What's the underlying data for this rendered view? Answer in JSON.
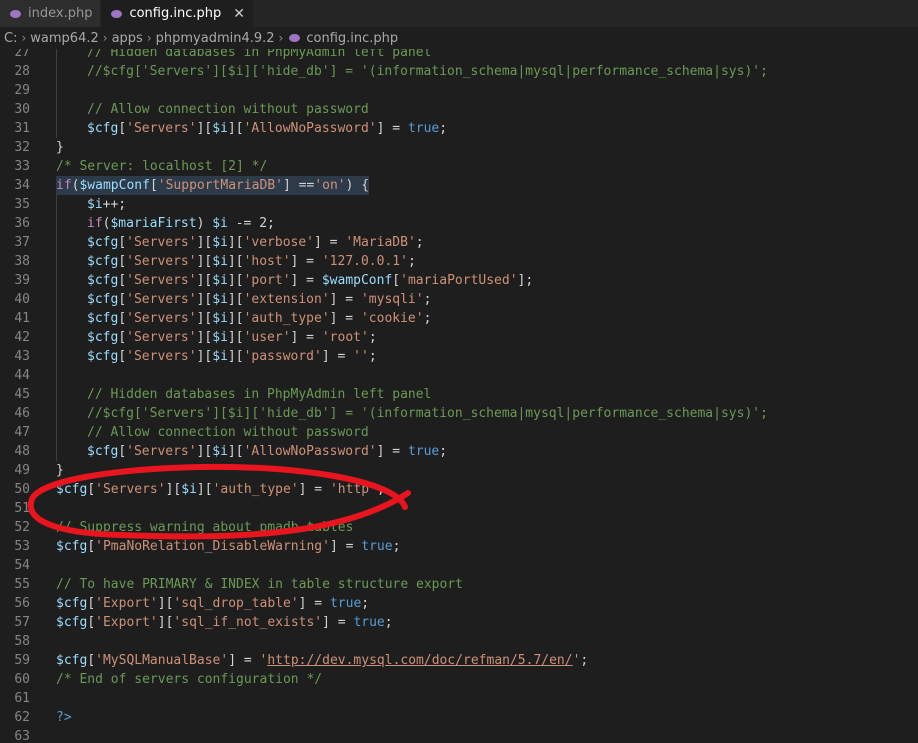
{
  "tabs": [
    {
      "label": "index.php",
      "active": false
    },
    {
      "label": "config.inc.php",
      "active": true,
      "close": "✕"
    }
  ],
  "breadcrumb": [
    "C:",
    "wamp64.2",
    "apps",
    "phpmyadmin4.9.2",
    "config.inc.php"
  ],
  "colors": {
    "keyword": "#569cd6",
    "string": "#ce9178",
    "comment": "#6a9955",
    "variable": "#9cdcfe",
    "annotation": "#e8141e"
  },
  "lines": [
    {
      "n": "27",
      "indent": 1,
      "t": [
        [
          "c",
          "// Hidden databases in PhpMyAdmin left panel"
        ]
      ]
    },
    {
      "n": "28",
      "indent": 1,
      "t": [
        [
          "c",
          "//$cfg['Servers'][$i]['hide_db'] = '(information_schema|mysql|performance_schema|sys)';"
        ]
      ]
    },
    {
      "n": "29",
      "indent": 1,
      "t": []
    },
    {
      "n": "30",
      "indent": 1,
      "t": [
        [
          "c",
          "// Allow connection without password"
        ]
      ]
    },
    {
      "n": "31",
      "indent": 1,
      "t": [
        [
          "v",
          "$cfg"
        ],
        [
          "",
          "["
        ],
        [
          "s",
          "'Servers'"
        ],
        [
          "",
          "]["
        ],
        [
          "v",
          "$i"
        ],
        [
          "",
          "]["
        ],
        [
          "s",
          "'AllowNoPassword'"
        ],
        [
          "",
          "] = "
        ],
        [
          "k",
          "true"
        ],
        [
          "",
          ";"
        ]
      ]
    },
    {
      "n": "32",
      "indent": 0,
      "t": [
        [
          "",
          "}"
        ]
      ]
    },
    {
      "n": "33",
      "indent": 0,
      "t": [
        [
          "c",
          "/* Server: localhost [2] */"
        ]
      ]
    },
    {
      "n": "34",
      "indent": 0,
      "hl": true,
      "t": [
        [
          "cf",
          "if"
        ],
        [
          "",
          "("
        ],
        [
          "v",
          "$wampConf"
        ],
        [
          "",
          "["
        ],
        [
          "s",
          "'SupportMariaDB'"
        ],
        [
          "",
          "] =="
        ],
        [
          "s",
          "'on'"
        ],
        [
          "",
          ") {"
        ]
      ]
    },
    {
      "n": "35",
      "indent": 1,
      "t": [
        [
          "v",
          "$i"
        ],
        [
          "",
          "++;"
        ]
      ]
    },
    {
      "n": "36",
      "indent": 1,
      "t": [
        [
          "cf",
          "if"
        ],
        [
          "",
          "("
        ],
        [
          "v",
          "$mariaFirst"
        ],
        [
          "",
          ") "
        ],
        [
          "v",
          "$i"
        ],
        [
          "",
          " -= 2;"
        ]
      ]
    },
    {
      "n": "37",
      "indent": 1,
      "t": [
        [
          "v",
          "$cfg"
        ],
        [
          "",
          "["
        ],
        [
          "s",
          "'Servers'"
        ],
        [
          "",
          "]["
        ],
        [
          "v",
          "$i"
        ],
        [
          "",
          "]["
        ],
        [
          "s",
          "'verbose'"
        ],
        [
          "",
          "] = "
        ],
        [
          "s",
          "'MariaDB'"
        ],
        [
          "",
          ";"
        ]
      ]
    },
    {
      "n": "38",
      "indent": 1,
      "t": [
        [
          "v",
          "$cfg"
        ],
        [
          "",
          "["
        ],
        [
          "s",
          "'Servers'"
        ],
        [
          "",
          "]["
        ],
        [
          "v",
          "$i"
        ],
        [
          "",
          "]["
        ],
        [
          "s",
          "'host'"
        ],
        [
          "",
          "] = "
        ],
        [
          "s",
          "'127.0.0.1'"
        ],
        [
          "",
          ";"
        ]
      ]
    },
    {
      "n": "39",
      "indent": 1,
      "t": [
        [
          "v",
          "$cfg"
        ],
        [
          "",
          "["
        ],
        [
          "s",
          "'Servers'"
        ],
        [
          "",
          "]["
        ],
        [
          "v",
          "$i"
        ],
        [
          "",
          "]["
        ],
        [
          "s",
          "'port'"
        ],
        [
          "",
          "] = "
        ],
        [
          "v",
          "$wampConf"
        ],
        [
          "",
          "["
        ],
        [
          "s",
          "'mariaPortUsed'"
        ],
        [
          "",
          "];"
        ]
      ]
    },
    {
      "n": "40",
      "indent": 1,
      "t": [
        [
          "v",
          "$cfg"
        ],
        [
          "",
          "["
        ],
        [
          "s",
          "'Servers'"
        ],
        [
          "",
          "]["
        ],
        [
          "v",
          "$i"
        ],
        [
          "",
          "]["
        ],
        [
          "s",
          "'extension'"
        ],
        [
          "",
          "] = "
        ],
        [
          "s",
          "'mysqli'"
        ],
        [
          "",
          ";"
        ]
      ]
    },
    {
      "n": "41",
      "indent": 1,
      "t": [
        [
          "v",
          "$cfg"
        ],
        [
          "",
          "["
        ],
        [
          "s",
          "'Servers'"
        ],
        [
          "",
          "]["
        ],
        [
          "v",
          "$i"
        ],
        [
          "",
          "]["
        ],
        [
          "s",
          "'auth_type'"
        ],
        [
          "",
          "] = "
        ],
        [
          "s",
          "'cookie'"
        ],
        [
          "",
          ";"
        ]
      ]
    },
    {
      "n": "42",
      "indent": 1,
      "t": [
        [
          "v",
          "$cfg"
        ],
        [
          "",
          "["
        ],
        [
          "s",
          "'Servers'"
        ],
        [
          "",
          "]["
        ],
        [
          "v",
          "$i"
        ],
        [
          "",
          "]["
        ],
        [
          "s",
          "'user'"
        ],
        [
          "",
          "] = "
        ],
        [
          "s",
          "'root'"
        ],
        [
          "",
          ";"
        ]
      ]
    },
    {
      "n": "43",
      "indent": 1,
      "t": [
        [
          "v",
          "$cfg"
        ],
        [
          "",
          "["
        ],
        [
          "s",
          "'Servers'"
        ],
        [
          "",
          "]["
        ],
        [
          "v",
          "$i"
        ],
        [
          "",
          "]["
        ],
        [
          "s",
          "'password'"
        ],
        [
          "",
          "] = "
        ],
        [
          "s",
          "''"
        ],
        [
          "",
          ";"
        ]
      ]
    },
    {
      "n": "44",
      "indent": 1,
      "t": []
    },
    {
      "n": "45",
      "indent": 1,
      "t": [
        [
          "c",
          "// Hidden databases in PhpMyAdmin left panel"
        ]
      ]
    },
    {
      "n": "46",
      "indent": 1,
      "t": [
        [
          "c",
          "//$cfg['Servers'][$i]['hide_db'] = '(information_schema|mysql|performance_schema|sys)';"
        ]
      ]
    },
    {
      "n": "47",
      "indent": 1,
      "t": [
        [
          "c",
          "// Allow connection without password"
        ]
      ]
    },
    {
      "n": "48",
      "indent": 1,
      "t": [
        [
          "v",
          "$cfg"
        ],
        [
          "",
          "["
        ],
        [
          "s",
          "'Servers'"
        ],
        [
          "",
          "]["
        ],
        [
          "v",
          "$i"
        ],
        [
          "",
          "]["
        ],
        [
          "s",
          "'AllowNoPassword'"
        ],
        [
          "",
          "] = "
        ],
        [
          "k",
          "true"
        ],
        [
          "",
          ";"
        ]
      ]
    },
    {
      "n": "49",
      "indent": 0,
      "t": [
        [
          "",
          "}"
        ]
      ]
    },
    {
      "n": "50",
      "indent": 0,
      "t": [
        [
          "v",
          "$cfg"
        ],
        [
          "",
          "["
        ],
        [
          "s",
          "'Servers'"
        ],
        [
          "",
          "]["
        ],
        [
          "v",
          "$i"
        ],
        [
          "",
          "]["
        ],
        [
          "s",
          "'auth_type'"
        ],
        [
          "",
          "] = "
        ],
        [
          "s",
          "'http'"
        ],
        [
          "",
          ";"
        ]
      ]
    },
    {
      "n": "51",
      "indent": 0,
      "t": []
    },
    {
      "n": "52",
      "indent": 0,
      "t": [
        [
          "c",
          "// Suppress warning about pmadb tables"
        ]
      ]
    },
    {
      "n": "53",
      "indent": 0,
      "t": [
        [
          "v",
          "$cfg"
        ],
        [
          "",
          "["
        ],
        [
          "s",
          "'PmaNoRelation_DisableWarning'"
        ],
        [
          "",
          "] = "
        ],
        [
          "k",
          "true"
        ],
        [
          "",
          ";"
        ]
      ]
    },
    {
      "n": "54",
      "indent": 0,
      "t": []
    },
    {
      "n": "55",
      "indent": 0,
      "t": [
        [
          "c",
          "// To have PRIMARY & INDEX in table structure export"
        ]
      ]
    },
    {
      "n": "56",
      "indent": 0,
      "t": [
        [
          "v",
          "$cfg"
        ],
        [
          "",
          "["
        ],
        [
          "s",
          "'Export'"
        ],
        [
          "",
          "]["
        ],
        [
          "s",
          "'sql_drop_table'"
        ],
        [
          "",
          "] = "
        ],
        [
          "k",
          "true"
        ],
        [
          "",
          ";"
        ]
      ]
    },
    {
      "n": "57",
      "indent": 0,
      "t": [
        [
          "v",
          "$cfg"
        ],
        [
          "",
          "["
        ],
        [
          "s",
          "'Export'"
        ],
        [
          "",
          "]["
        ],
        [
          "s",
          "'sql_if_not_exists'"
        ],
        [
          "",
          "] = "
        ],
        [
          "k",
          "true"
        ],
        [
          "",
          ";"
        ]
      ]
    },
    {
      "n": "58",
      "indent": 0,
      "t": []
    },
    {
      "n": "59",
      "indent": 0,
      "t": [
        [
          "v",
          "$cfg"
        ],
        [
          "",
          "["
        ],
        [
          "s",
          "'MySQLManualBase'"
        ],
        [
          "",
          "] = "
        ],
        [
          "s",
          "'"
        ],
        [
          "u",
          "http://dev.mysql.com/doc/refman/5.7/en/"
        ],
        [
          "s",
          "'"
        ],
        [
          "",
          ";"
        ]
      ]
    },
    {
      "n": "60",
      "indent": 0,
      "t": [
        [
          "c",
          "/* End of servers configuration */"
        ]
      ]
    },
    {
      "n": "61",
      "indent": 0,
      "t": []
    },
    {
      "n": "62",
      "indent": 0,
      "t": [
        [
          "k",
          "?>"
        ]
      ]
    },
    {
      "n": "63",
      "indent": 0,
      "t": []
    }
  ]
}
